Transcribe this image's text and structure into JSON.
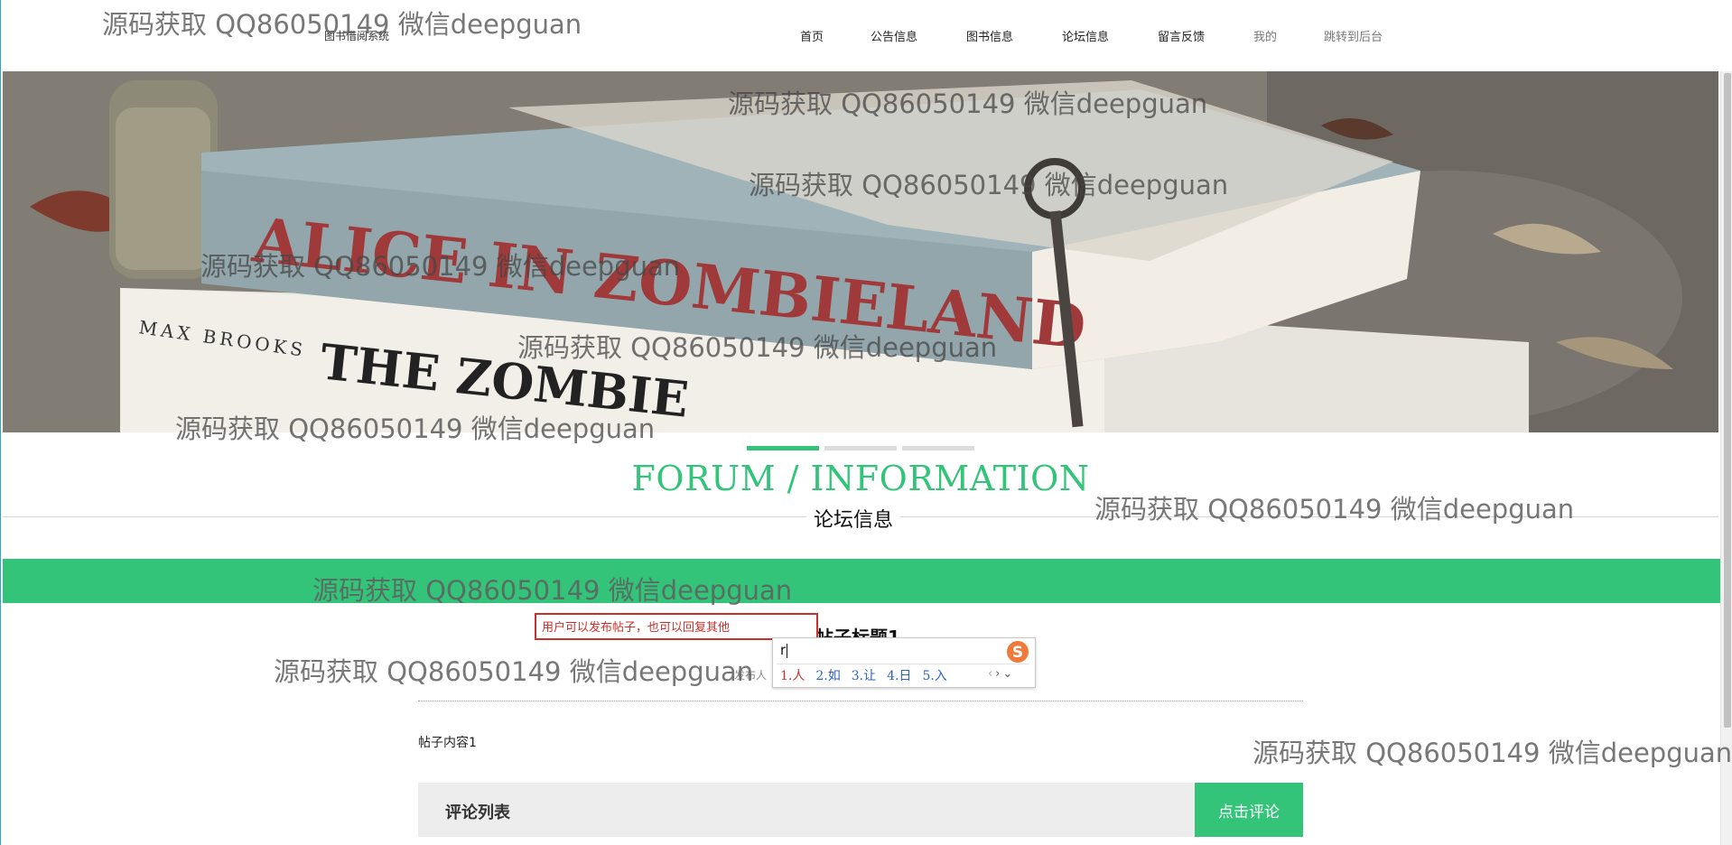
{
  "header": {
    "site_name": "图书借阅系统",
    "nav": [
      {
        "label": "首页"
      },
      {
        "label": "公告信息"
      },
      {
        "label": "图书信息"
      },
      {
        "label": "论坛信息"
      },
      {
        "label": "留言反馈"
      },
      {
        "label": "我的"
      },
      {
        "label": "跳转到后台"
      }
    ]
  },
  "banner": {
    "book_title": "ALICE IN ZOMBIELAND",
    "author": "MAX BROOKS",
    "second_book": "THE ZOMBIE"
  },
  "carousel": {
    "count": 3,
    "active_index": 0
  },
  "section": {
    "title_en": "FORUM / INFORMATION",
    "title_cn": "论坛信息"
  },
  "post": {
    "title": "帖子标题1",
    "meta": "发布人",
    "content": "帖子内容1"
  },
  "comments": {
    "title": "评论列表",
    "button": "点击评论"
  },
  "tooltip": "用户可以发布帖子，也可以回复其他",
  "ime": {
    "input": "r",
    "candidates": [
      "1.人",
      "2.如",
      "3.让",
      "4.日",
      "5.入"
    ],
    "prev": "‹",
    "next": "›",
    "more": "⌄"
  },
  "watermark": "源码获取 QQ86050149 微信deepguan",
  "colors": {
    "accent": "#33c47a",
    "tooltip_red": "#c9302c",
    "ime_blue": "#2a63c6"
  }
}
